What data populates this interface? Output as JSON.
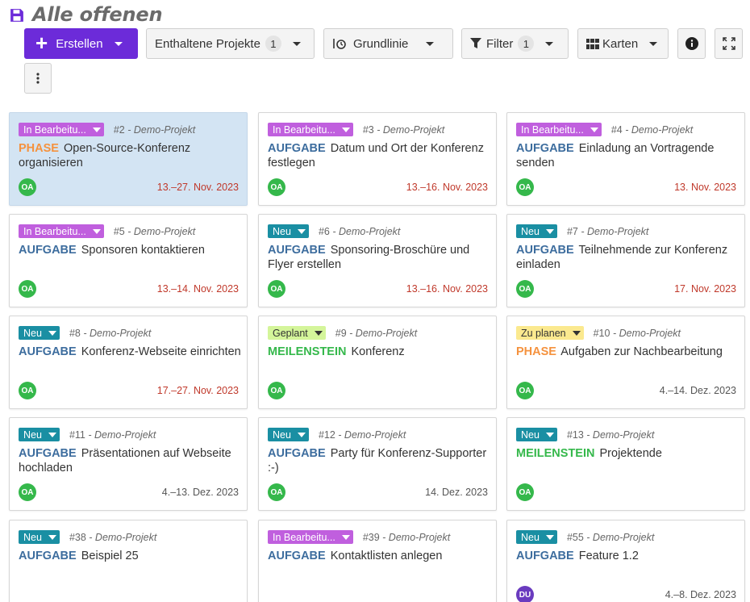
{
  "page": {
    "title": "Alle offenen"
  },
  "toolbar": {
    "create_label": "Erstellen",
    "projects_label": "Enthaltene Projekte",
    "projects_count": "1",
    "baseline_label": "Grundlinie",
    "filter_label": "Filter",
    "filter_count": "1",
    "view_label": "Karten"
  },
  "colors": {
    "accent": "#6c2bd9",
    "overdue": "#c0392b",
    "type_task": "#3d6d9e",
    "type_phase": "#f5923e",
    "type_milestone": "#35b84b"
  },
  "cards": [
    {
      "status": "In Bearbeitu...",
      "status_color": "#c05fde",
      "id": "#2",
      "project": "Demo-Projekt",
      "type": "PHASE",
      "type_color": "#f5923e",
      "title": "Open-Source-Konferenz organisieren",
      "assignee": "OA",
      "avatar_color": "#35b84b",
      "date": "13.–27. Nov. 2023",
      "date_color": "#c0392b",
      "selected": true
    },
    {
      "status": "In Bearbeitu...",
      "status_color": "#c05fde",
      "id": "#3",
      "project": "Demo-Projekt",
      "type": "AUFGABE",
      "type_color": "#3d6d9e",
      "title": "Datum und Ort der Konferenz festlegen",
      "assignee": "OA",
      "avatar_color": "#35b84b",
      "date": "13.–16. Nov. 2023",
      "date_color": "#c0392b"
    },
    {
      "status": "In Bearbeitu...",
      "status_color": "#c05fde",
      "id": "#4",
      "project": "Demo-Projekt",
      "type": "AUFGABE",
      "type_color": "#3d6d9e",
      "title": "Einladung an Vortragende senden",
      "assignee": "OA",
      "avatar_color": "#35b84b",
      "date": "13. Nov. 2023",
      "date_color": "#c0392b"
    },
    {
      "status": "In Bearbeitu...",
      "status_color": "#c05fde",
      "id": "#5",
      "project": "Demo-Projekt",
      "type": "AUFGABE",
      "type_color": "#3d6d9e",
      "title": "Sponsoren kontaktieren",
      "assignee": "OA",
      "avatar_color": "#35b84b",
      "date": "13.–14. Nov. 2023",
      "date_color": "#c0392b"
    },
    {
      "status": "Neu",
      "status_color": "#1a8fa3",
      "id": "#6",
      "project": "Demo-Projekt",
      "type": "AUFGABE",
      "type_color": "#3d6d9e",
      "title": "Sponsoring-Broschüre und Flyer erstellen",
      "assignee": "OA",
      "avatar_color": "#35b84b",
      "date": "13.–16. Nov. 2023",
      "date_color": "#c0392b"
    },
    {
      "status": "Neu",
      "status_color": "#1a8fa3",
      "id": "#7",
      "project": "Demo-Projekt",
      "type": "AUFGABE",
      "type_color": "#3d6d9e",
      "title": "Teilnehmende zur Konferenz einladen",
      "assignee": "OA",
      "avatar_color": "#35b84b",
      "date": "17. Nov. 2023",
      "date_color": "#c0392b"
    },
    {
      "status": "Neu",
      "status_color": "#1a8fa3",
      "id": "#8",
      "project": "Demo-Projekt",
      "type": "AUFGABE",
      "type_color": "#3d6d9e",
      "title": "Konferenz-Webseite einrichten",
      "assignee": "OA",
      "avatar_color": "#35b84b",
      "date": "17.–27. Nov. 2023",
      "date_color": "#c0392b"
    },
    {
      "status": "Geplant",
      "status_color": "#d4f59a",
      "status_text_color": "#333333",
      "id": "#9",
      "project": "Demo-Projekt",
      "type": "MEILENSTEIN",
      "type_color": "#35b84b",
      "title": "Konferenz",
      "assignee": "OA",
      "avatar_color": "#35b84b",
      "date": "",
      "date_color": "#555555"
    },
    {
      "status": "Zu planen",
      "status_color": "#fbe98f",
      "status_text_color": "#333333",
      "id": "#10",
      "project": "Demo-Projekt",
      "type": "PHASE",
      "type_color": "#f5923e",
      "title": "Aufgaben zur Nachbearbeitung",
      "assignee": "OA",
      "avatar_color": "#35b84b",
      "date": "4.–14. Dez. 2023",
      "date_color": "#555555"
    },
    {
      "status": "Neu",
      "status_color": "#1a8fa3",
      "id": "#11",
      "project": "Demo-Projekt",
      "type": "AUFGABE",
      "type_color": "#3d6d9e",
      "title": "Präsentationen auf Webseite hochladen",
      "assignee": "OA",
      "avatar_color": "#35b84b",
      "date": "4.–13. Dez. 2023",
      "date_color": "#555555"
    },
    {
      "status": "Neu",
      "status_color": "#1a8fa3",
      "id": "#12",
      "project": "Demo-Projekt",
      "type": "AUFGABE",
      "type_color": "#3d6d9e",
      "title": "Party für Konferenz-Supporter :-)",
      "assignee": "OA",
      "avatar_color": "#35b84b",
      "date": "14. Dez. 2023",
      "date_color": "#555555"
    },
    {
      "status": "Neu",
      "status_color": "#1a8fa3",
      "id": "#13",
      "project": "Demo-Projekt",
      "type": "MEILENSTEIN",
      "type_color": "#35b84b",
      "title": "Projektende",
      "assignee": "OA",
      "avatar_color": "#35b84b",
      "date": "",
      "date_color": "#555555"
    },
    {
      "status": "Neu",
      "status_color": "#1a8fa3",
      "id": "#38",
      "project": "Demo-Projekt",
      "type": "AUFGABE",
      "type_color": "#3d6d9e",
      "title": "Beispiel 25",
      "assignee": "",
      "avatar_color": "#35b84b",
      "date": "",
      "date_color": "#555555"
    },
    {
      "status": "In Bearbeitu...",
      "status_color": "#c05fde",
      "id": "#39",
      "project": "Demo-Projekt",
      "type": "AUFGABE",
      "type_color": "#3d6d9e",
      "title": "Kontaktlisten anlegen",
      "assignee": "",
      "avatar_color": "#35b84b",
      "date": "",
      "date_color": "#555555"
    },
    {
      "status": "Neu",
      "status_color": "#1a8fa3",
      "id": "#55",
      "project": "Demo-Projekt",
      "type": "AUFGABE",
      "type_color": "#3d6d9e",
      "title": "Feature 1.2",
      "assignee": "DU",
      "avatar_color": "#6a3bbf",
      "date": "4.–8. Dez. 2023",
      "date_color": "#555555"
    }
  ]
}
